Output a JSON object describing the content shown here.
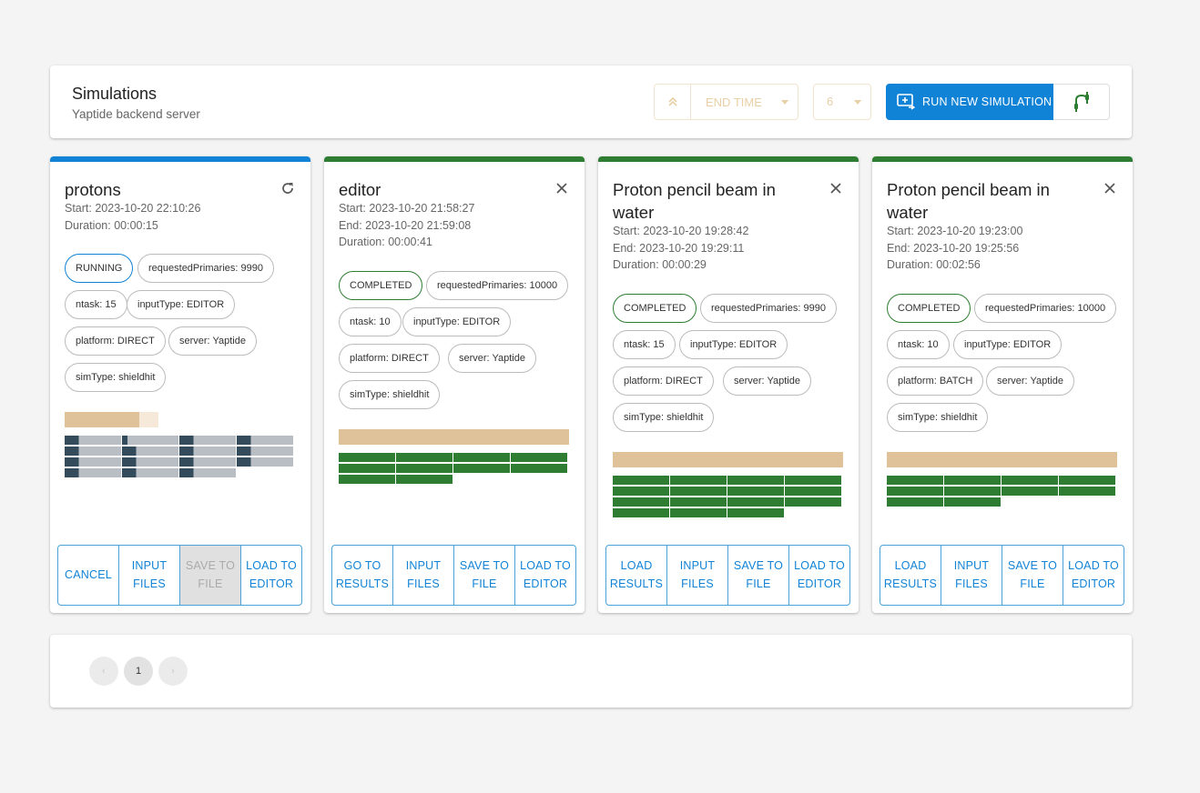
{
  "header": {
    "title": "Simulations",
    "subtitle": "Yaptide backend server",
    "sort_field": "END TIME",
    "page_size": "6",
    "run_button_label": "RUN NEW SIMULATION"
  },
  "colors": {
    "accent": "#1183d6",
    "completed": "#2e7d32",
    "running": "#1183d6",
    "progress": "#dfc19a",
    "pending_task": "#b8bec3",
    "dark_task": "#344b5c"
  },
  "cards": [
    {
      "title": "protons",
      "state": "running",
      "icon": "refresh-icon",
      "meta": [
        "Start: 2023-10-20 22:10:26",
        "Duration: 00:00:15"
      ],
      "chips": [
        "RUNNING",
        "requestedPrimaries: 9990",
        "ntask: 15",
        "inputType: EDITOR",
        "platform: DIRECT",
        "server: Yaptide",
        "simType: shieldhit"
      ],
      "progress": 0.8,
      "tasks": [
        0.25,
        0.1,
        0.25,
        0.25,
        0.25,
        0.25,
        0.25,
        0.25,
        0.25,
        0.25,
        0.25,
        0.25,
        0.25,
        0.25,
        0.25
      ],
      "actions": [
        "CANCEL",
        "INPUT FILES",
        "SAVE TO FILE",
        "LOAD TO EDITOR"
      ],
      "disabled_action": 2
    },
    {
      "title": "editor",
      "state": "completed",
      "icon": "close-icon",
      "meta": [
        "Start: 2023-10-20 21:58:27",
        "End: 2023-10-20 21:59:08",
        "Duration: 00:00:41"
      ],
      "chips": [
        "COMPLETED",
        "requestedPrimaries: 10000",
        "ntask: 10",
        "inputType: EDITOR",
        "platform: DIRECT",
        "server: Yaptide",
        "simType: shieldhit"
      ],
      "progress": 1,
      "tasks": [
        1,
        1,
        1,
        1,
        1,
        1,
        1,
        1,
        1,
        1
      ],
      "actions": [
        "GO TO RESULTS",
        "INPUT FILES",
        "SAVE TO FILE",
        "LOAD TO EDITOR"
      ],
      "disabled_action": -1
    },
    {
      "title": "Proton pencil beam in water",
      "state": "completed",
      "icon": "close-icon",
      "meta": [
        "Start: 2023-10-20 19:28:42",
        "End: 2023-10-20 19:29:11",
        "Duration: 00:00:29"
      ],
      "chips": [
        "COMPLETED",
        "requestedPrimaries: 9990",
        "ntask: 15",
        "inputType: EDITOR",
        "platform: DIRECT",
        "server: Yaptide",
        "simType: shieldhit"
      ],
      "progress": 1,
      "tasks": [
        1,
        1,
        1,
        1,
        1,
        1,
        1,
        1,
        1,
        1,
        1,
        1,
        1,
        1,
        1
      ],
      "actions": [
        "LOAD RESULTS",
        "INPUT FILES",
        "SAVE TO FILE",
        "LOAD TO EDITOR"
      ],
      "disabled_action": -1
    },
    {
      "title": "Proton pencil beam in water",
      "state": "completed",
      "icon": "close-icon",
      "meta": [
        "Start: 2023-10-20 19:23:00",
        "End: 2023-10-20 19:25:56",
        "Duration: 00:02:56"
      ],
      "chips": [
        "COMPLETED",
        "requestedPrimaries: 10000",
        "ntask: 10",
        "inputType: EDITOR",
        "platform: BATCH",
        "server: Yaptide",
        "simType: shieldhit"
      ],
      "progress": 1,
      "tasks": [
        1,
        1,
        1,
        1,
        1,
        1,
        1,
        1,
        1,
        1
      ],
      "actions": [
        "LOAD RESULTS",
        "INPUT FILES",
        "SAVE TO FILE",
        "LOAD TO EDITOR"
      ],
      "disabled_action": -1
    }
  ],
  "pagination": {
    "prev": "‹",
    "current": "1",
    "next": "›"
  }
}
